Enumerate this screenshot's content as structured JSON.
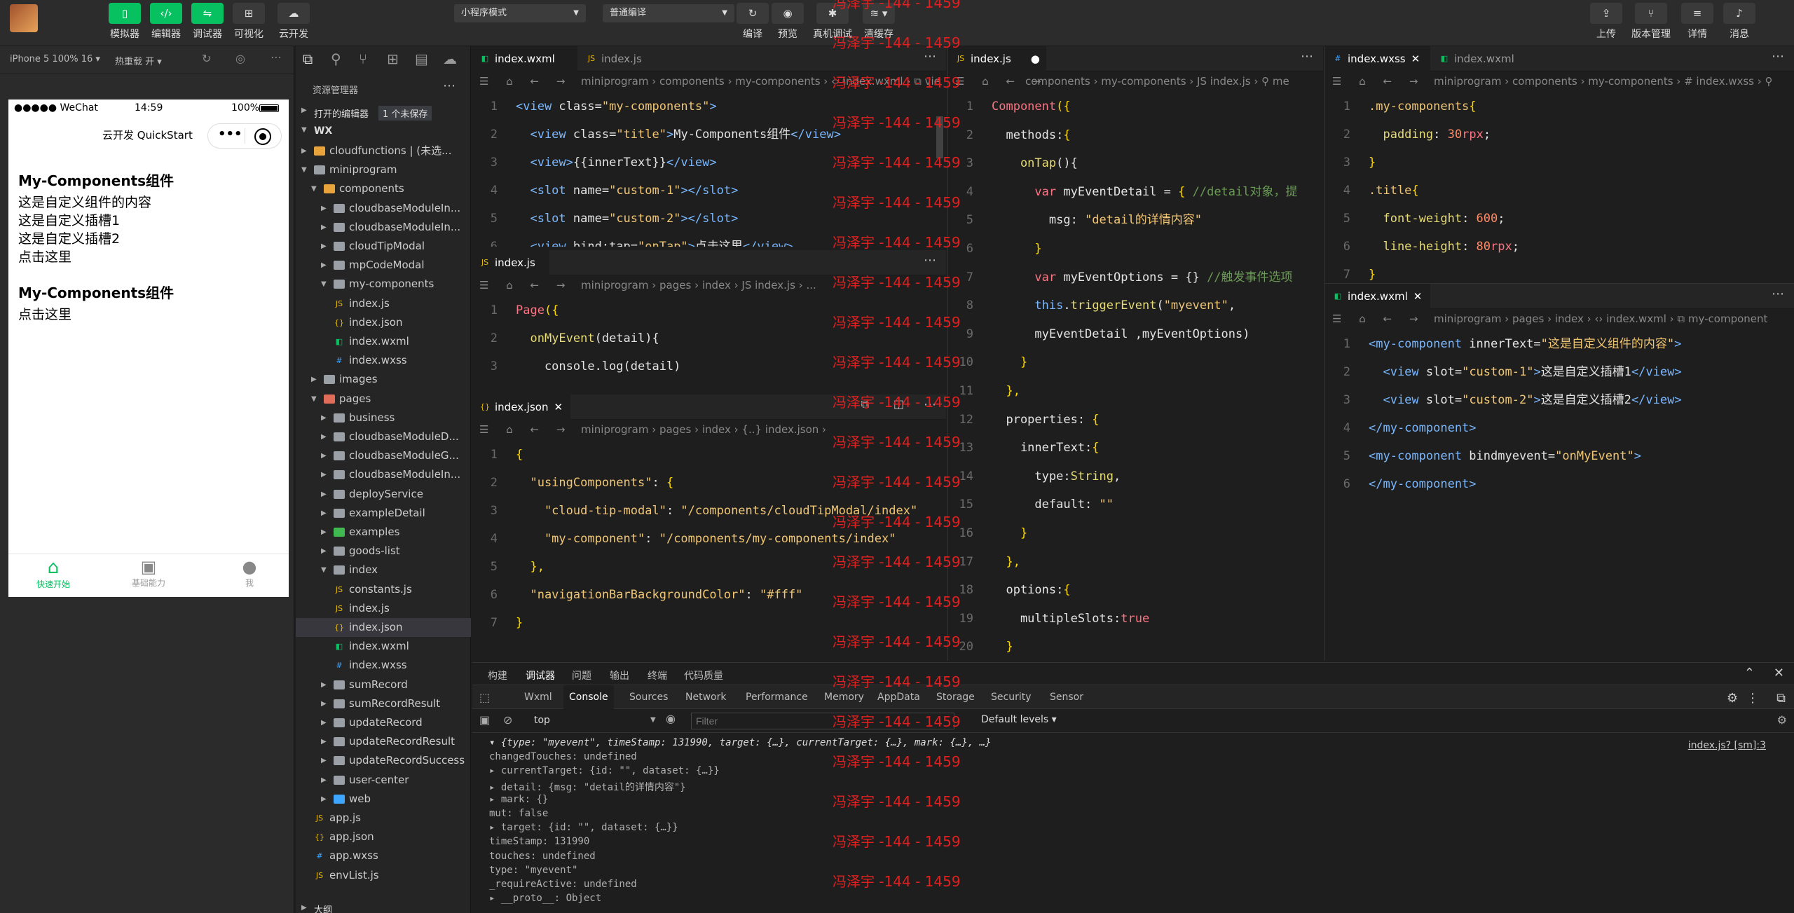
{
  "toolbar": {
    "left_buttons": [
      "模拟器",
      "编辑器",
      "调试器",
      "可视化",
      "云开发"
    ],
    "mode_select": "小程序模式",
    "compile_select": "普通编译",
    "center_buttons": [
      "编译",
      "预览",
      "真机调试",
      "清缓存"
    ],
    "right_buttons": [
      "上传",
      "版本管理",
      "详情",
      "消息"
    ]
  },
  "simulator": {
    "device": "iPhone 5 100% 16 ▾",
    "hot_reload": "热重载 开 ▾",
    "status_carrier": "●●●●● WeChat",
    "status_time": "14:59",
    "status_battery": "100%",
    "nav_title": "云开发 QuickStart",
    "content": [
      {
        "kind": "h",
        "text": "My-Components组件"
      },
      {
        "kind": "p",
        "text": "这是自定义组件的内容"
      },
      {
        "kind": "p",
        "text": "这是自定义插槽1"
      },
      {
        "kind": "p",
        "text": "这是自定义插槽2"
      },
      {
        "kind": "p",
        "text": "点击这里"
      },
      {
        "kind": "h",
        "text": "My-Components组件"
      },
      {
        "kind": "p",
        "text": "点击这里"
      }
    ],
    "tabbar": [
      {
        "label": "快速开始",
        "active": true
      },
      {
        "label": "基础能力",
        "active": false
      },
      {
        "label": "我",
        "active": false
      }
    ]
  },
  "explorer": {
    "title": "资源管理器",
    "open_editors": "打开的编辑器",
    "unsaved_badge": "1 个未保存",
    "root": "WX",
    "items": [
      {
        "name": "cloudfunctions | (未选...",
        "depth": 1,
        "type": "folder",
        "open": false
      },
      {
        "name": "miniprogram",
        "depth": 1,
        "type": "folder-plain",
        "open": true
      },
      {
        "name": "components",
        "depth": 2,
        "type": "folder",
        "open": true
      },
      {
        "name": "cloudbaseModuleIn...",
        "depth": 3,
        "type": "folder-plain",
        "open": false
      },
      {
        "name": "cloudbaseModuleIn...",
        "depth": 3,
        "type": "folder-plain",
        "open": false
      },
      {
        "name": "cloudTipModal",
        "depth": 3,
        "type": "folder-plain",
        "open": false
      },
      {
        "name": "mpCodeModal",
        "depth": 3,
        "type": "folder-plain",
        "open": false
      },
      {
        "name": "my-components",
        "depth": 3,
        "type": "folder-plain",
        "open": true
      },
      {
        "name": "index.js",
        "depth": 4,
        "type": "js"
      },
      {
        "name": "index.json",
        "depth": 4,
        "type": "json"
      },
      {
        "name": "index.wxml",
        "depth": 4,
        "type": "wxml"
      },
      {
        "name": "index.wxss",
        "depth": 4,
        "type": "wxss"
      },
      {
        "name": "images",
        "depth": 2,
        "type": "folder-plain",
        "open": false
      },
      {
        "name": "pages",
        "depth": 2,
        "type": "folder-red",
        "open": true
      },
      {
        "name": "business",
        "depth": 3,
        "type": "folder-plain",
        "open": false
      },
      {
        "name": "cloudbaseModuleD...",
        "depth": 3,
        "type": "folder-plain",
        "open": false
      },
      {
        "name": "cloudbaseModuleG...",
        "depth": 3,
        "type": "folder-plain",
        "open": false
      },
      {
        "name": "cloudbaseModuleIn...",
        "depth": 3,
        "type": "folder-plain",
        "open": false
      },
      {
        "name": "deployService",
        "depth": 3,
        "type": "folder-plain",
        "open": false
      },
      {
        "name": "exampleDetail",
        "depth": 3,
        "type": "folder-plain",
        "open": false
      },
      {
        "name": "examples",
        "depth": 3,
        "type": "folder-green",
        "open": false
      },
      {
        "name": "goods-list",
        "depth": 3,
        "type": "folder-plain",
        "open": false
      },
      {
        "name": "index",
        "depth": 3,
        "type": "folder-plain",
        "open": true
      },
      {
        "name": "constants.js",
        "depth": 4,
        "type": "js"
      },
      {
        "name": "index.js",
        "depth": 4,
        "type": "js"
      },
      {
        "name": "index.json",
        "depth": 4,
        "type": "json",
        "selected": true
      },
      {
        "name": "index.wxml",
        "depth": 4,
        "type": "wxml"
      },
      {
        "name": "index.wxss",
        "depth": 4,
        "type": "wxss"
      },
      {
        "name": "sumRecord",
        "depth": 3,
        "type": "folder-plain",
        "open": false
      },
      {
        "name": "sumRecordResult",
        "depth": 3,
        "type": "folder-plain",
        "open": false
      },
      {
        "name": "updateRecord",
        "depth": 3,
        "type": "folder-plain",
        "open": false
      },
      {
        "name": "updateRecordResult",
        "depth": 3,
        "type": "folder-plain",
        "open": false
      },
      {
        "name": "updateRecordSuccess",
        "depth": 3,
        "type": "folder-plain",
        "open": false
      },
      {
        "name": "user-center",
        "depth": 3,
        "type": "folder-plain",
        "open": false
      },
      {
        "name": "web",
        "depth": 3,
        "type": "folder-blue",
        "open": false
      },
      {
        "name": "app.js",
        "depth": 2,
        "type": "js"
      },
      {
        "name": "app.json",
        "depth": 2,
        "type": "json"
      },
      {
        "name": "app.wxss",
        "depth": 2,
        "type": "wxss"
      },
      {
        "name": "envList.js",
        "depth": 2,
        "type": "js"
      }
    ],
    "outline": "大纲"
  },
  "editor1": {
    "tabs": [
      "index.wxml",
      "index.js"
    ],
    "crumb": "miniprogram › components › my-components › ‹› index.wxml › ⧉ vie",
    "lines": [
      [
        [
          "t",
          "<view "
        ],
        [
          "a",
          "class="
        ],
        [
          "s",
          "\"my-components\""
        ],
        [
          "t",
          ">"
        ]
      ],
      [
        [
          "t",
          "  <view "
        ],
        [
          "a",
          "class="
        ],
        [
          "s",
          "\"title\""
        ],
        [
          "t",
          ">"
        ],
        [
          "v",
          "My-Components组件"
        ],
        [
          "t",
          "</view>"
        ]
      ],
      [
        [
          "t",
          "  <view>"
        ],
        [
          "v",
          "{{innerText}}"
        ],
        [
          "t",
          "</view>"
        ]
      ],
      [
        [
          "t",
          "  <slot "
        ],
        [
          "a",
          "name="
        ],
        [
          "s",
          "\"custom-1\""
        ],
        [
          "t",
          "></slot>"
        ]
      ],
      [
        [
          "t",
          "  <slot "
        ],
        [
          "a",
          "name="
        ],
        [
          "s",
          "\"custom-2\""
        ],
        [
          "t",
          "></slot>"
        ]
      ],
      [
        [
          "t",
          "  <view "
        ],
        [
          "a",
          "bind:tap="
        ],
        [
          "s",
          "\"onTap\""
        ],
        [
          "t",
          ">"
        ],
        [
          "v",
          "点击这里"
        ],
        [
          "t",
          "</view>"
        ]
      ]
    ]
  },
  "editor2": {
    "tab": "index.js",
    "crumb": "miniprogram › pages › index › JS index.js › ...",
    "lines": [
      [
        [
          "k",
          "Page"
        ],
        [
          "b",
          "({"
        ]
      ],
      [
        [
          "f",
          "  onMyEvent"
        ],
        [
          "v",
          "(detail){"
        ]
      ],
      [
        [
          "v",
          "    console.log(detail)"
        ]
      ]
    ]
  },
  "editor3": {
    "tab": "index.json",
    "crumb": "miniprogram › pages › index › {..} index.json ›",
    "lines": [
      [
        [
          "b",
          "{"
        ]
      ],
      [
        [
          "s",
          "  \"usingComponents\""
        ],
        [
          "v",
          ": "
        ],
        [
          "b",
          "{"
        ]
      ],
      [
        [
          "s",
          "    \"cloud-tip-modal\""
        ],
        [
          "v",
          ": "
        ],
        [
          "s",
          "\"/components/cloudTipModal/index\""
        ]
      ],
      [
        [
          "s",
          "    \"my-component\""
        ],
        [
          "v",
          ": "
        ],
        [
          "s",
          "\"/components/my-components/index\""
        ]
      ],
      [
        [
          "b",
          "  },"
        ]
      ],
      [
        [
          "s",
          "  \"navigationBarBackgroundColor\""
        ],
        [
          "v",
          ": "
        ],
        [
          "s",
          "\"#fff\""
        ]
      ],
      [
        [
          "b",
          "}"
        ]
      ]
    ]
  },
  "editor4": {
    "tab": "index.js",
    "crumb": "components › my-components › JS index.js › ⚲ me",
    "lines": [
      [
        [
          "k",
          "Component"
        ],
        [
          "b",
          "({"
        ]
      ],
      [
        [
          "v",
          "  methods:"
        ],
        [
          "b",
          "{"
        ]
      ],
      [
        [
          "f",
          "    onTap"
        ],
        [
          "v",
          "(){"
        ]
      ],
      [
        [
          "k",
          "      var "
        ],
        [
          "v",
          "myEventDetail = "
        ],
        [
          "b",
          "{ "
        ],
        [
          "c",
          "//detail对象，提"
        ]
      ],
      [
        [
          "v",
          "        msg: "
        ],
        [
          "s",
          "\"detail的详情内容\""
        ]
      ],
      [
        [
          "b",
          "      }"
        ]
      ],
      [
        [
          "k",
          "      var "
        ],
        [
          "v",
          "myEventOptions = {} "
        ],
        [
          "c",
          "//触发事件选项"
        ]
      ],
      [
        [
          "t",
          "      this"
        ],
        [
          "v",
          "."
        ],
        [
          "f",
          "triggerEvent"
        ],
        [
          "v",
          "("
        ],
        [
          "s",
          "\"myevent\""
        ],
        [
          "v",
          ","
        ]
      ],
      [
        [
          "v",
          "      myEventDetail ,myEventOptions)"
        ]
      ],
      [
        [
          "b",
          "    }"
        ]
      ],
      [
        [
          "b",
          "  },"
        ]
      ],
      [
        [
          "v",
          "  properties: "
        ],
        [
          "b",
          "{"
        ]
      ],
      [
        [
          "v",
          "    innerText:"
        ],
        [
          "b",
          "{"
        ]
      ],
      [
        [
          "v",
          "      type:"
        ],
        [
          "f",
          "String"
        ],
        [
          "v",
          ","
        ]
      ],
      [
        [
          "v",
          "      default: "
        ],
        [
          "s",
          "\"\""
        ]
      ],
      [
        [
          "b",
          "    }"
        ]
      ],
      [
        [
          "b",
          "  },"
        ]
      ],
      [
        [
          "v",
          "  options:"
        ],
        [
          "b",
          "{"
        ]
      ],
      [
        [
          "v",
          "    multipleSlots:"
        ],
        [
          "k",
          "true"
        ]
      ],
      [
        [
          "b",
          "  }"
        ]
      ]
    ]
  },
  "editor5": {
    "tabs": [
      "index.wxss",
      "index.wxml"
    ],
    "crumb": "miniprogram › components › my-components › # index.wxss › ⚲",
    "lines": [
      [
        [
          "s",
          ".my-components"
        ],
        [
          "b",
          "{"
        ]
      ],
      [
        [
          "f",
          "  padding"
        ],
        [
          "v",
          ": "
        ],
        [
          "n",
          "30"
        ],
        [
          "k",
          "rpx"
        ],
        [
          "v",
          ";"
        ]
      ],
      [
        [
          "b",
          "}"
        ]
      ],
      [
        [
          "s",
          ".title"
        ],
        [
          "b",
          "{"
        ]
      ],
      [
        [
          "f",
          "  font-weight"
        ],
        [
          "v",
          ": "
        ],
        [
          "n",
          "600"
        ],
        [
          "v",
          ";"
        ]
      ],
      [
        [
          "f",
          "  line-height"
        ],
        [
          "v",
          ": "
        ],
        [
          "n",
          "80"
        ],
        [
          "k",
          "rpx"
        ],
        [
          "v",
          ";"
        ]
      ],
      [
        [
          "b",
          "}"
        ]
      ]
    ]
  },
  "editor6": {
    "tab": "index.wxml",
    "crumb": "miniprogram › pages › index › ‹› index.wxml › ⧉ my-component",
    "lines": [
      [
        [
          "t",
          "<my-component "
        ],
        [
          "a",
          "innerText="
        ],
        [
          "s",
          "\"这是自定义组件的内容\""
        ],
        [
          "t",
          ">"
        ]
      ],
      [
        [
          "t",
          "  <view "
        ],
        [
          "a",
          "slot="
        ],
        [
          "s",
          "\"custom-1\""
        ],
        [
          "t",
          ">"
        ],
        [
          "v",
          "这是自定义插槽1"
        ],
        [
          "t",
          "</view>"
        ]
      ],
      [
        [
          "t",
          "  <view "
        ],
        [
          "a",
          "slot="
        ],
        [
          "s",
          "\"custom-2\""
        ],
        [
          "t",
          ">"
        ],
        [
          "v",
          "这是自定义插槽2"
        ],
        [
          "t",
          "</view>"
        ]
      ],
      [
        [
          "t",
          "</my-component>"
        ]
      ],
      [
        [
          "t",
          "<my-component "
        ],
        [
          "a",
          "bindmyevent="
        ],
        [
          "s",
          "\"onMyEvent\""
        ],
        [
          "t",
          ">"
        ]
      ],
      [
        [
          "t",
          "</my-component>"
        ]
      ]
    ]
  },
  "watermark": "冯泽宇 -144 - 1459",
  "devtools": {
    "top_tabs": [
      "构建",
      "调试器",
      "问题",
      "输出",
      "终端",
      "代码质量"
    ],
    "panel_tabs": [
      "Wxml",
      "Console",
      "Sources",
      "Network",
      "Performance",
      "Memory",
      "AppData",
      "Storage",
      "Security",
      "Sensor"
    ],
    "context": "top",
    "filter_placeholder": "Filter",
    "levels": "Default levels ▾",
    "source_link": "index.js? [sm]:3",
    "console_lines": [
      "▾ {type: \"myevent\", timeStamp: 131990, target: {…}, currentTarget: {…}, mark: {…}, …}",
      "    changedTouches: undefined",
      "  ▸ currentTarget: {id: \"\", dataset: {…}}",
      "  ▸ detail: {msg: \"detail的详情内容\"}",
      "  ▸ mark: {}",
      "    mut: false",
      "  ▸ target: {id: \"\", dataset: {…}}",
      "    timeStamp: 131990",
      "    touches: undefined",
      "    type: \"myevent\"",
      "    _requireActive: undefined",
      "  ▸ __proto__: Object"
    ]
  },
  "colors": {
    "accent": "#07c160",
    "bg": "#1e1e1e",
    "watermark": "#e02020"
  }
}
